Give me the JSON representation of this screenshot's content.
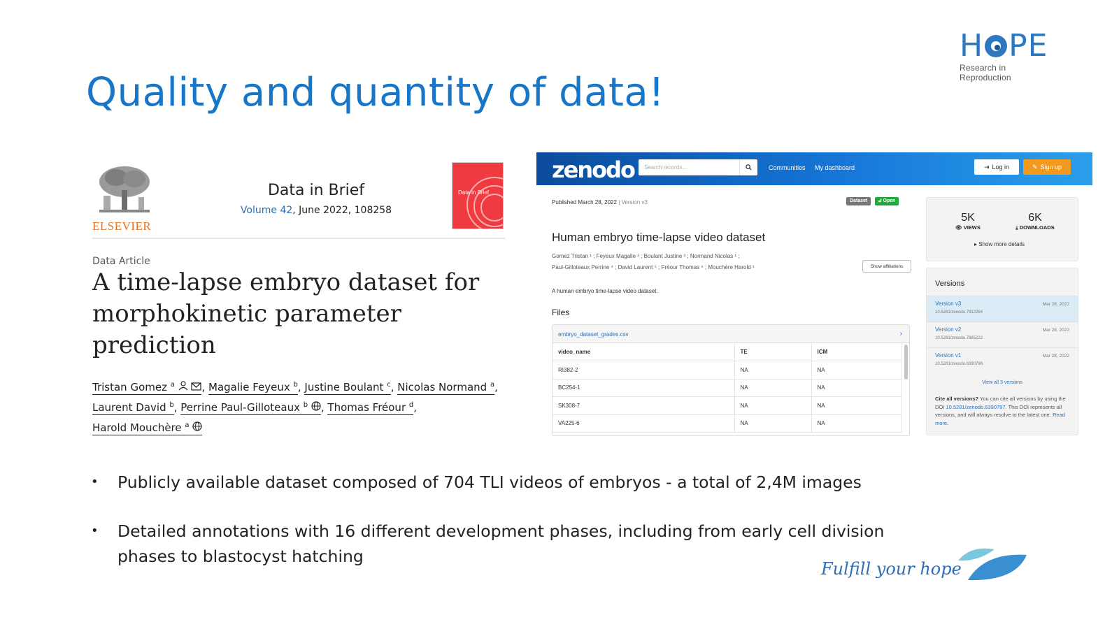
{
  "slide": {
    "title": "Quality and quantity of data!",
    "logo_word": "HOPE",
    "logo_sub": "Research in Reproduction",
    "tagline": "Fulfill your hope"
  },
  "article": {
    "publisher": "ELSEVIER",
    "journal": "Data in Brief",
    "volume_link": "Volume 42",
    "volume_rest": ", June 2022, 108258",
    "cover_text": "Data in Brief",
    "type": "Data Article",
    "title": "A time-lapse embryo dataset for morphokinetic parameter prediction",
    "authors": [
      {
        "name": "Tristan Gomez",
        "sup": "a"
      },
      {
        "name": "Magalie Feyeux",
        "sup": "b"
      },
      {
        "name": "Justine Boulant",
        "sup": "c"
      },
      {
        "name": "Nicolas Normand",
        "sup": "a"
      },
      {
        "name": "Laurent David",
        "sup": "b"
      },
      {
        "name": "Perrine Paul-Gilloteaux",
        "sup": "b"
      },
      {
        "name": "Thomas Fréour",
        "sup": "d"
      },
      {
        "name": "Harold Mouchère",
        "sup": "a"
      }
    ]
  },
  "zenodo": {
    "logo": "zenodo",
    "search_placeholder": "Search records...",
    "nav": [
      "Communities",
      "My dashboard"
    ],
    "login": "Log in",
    "signup": "Sign up",
    "published": "Published March 28, 2022",
    "version": "| Version v3",
    "badges": [
      "Dataset",
      "Open"
    ],
    "title": "Human embryo time-lapse video dataset",
    "authors_line1": "Gomez Tristan ¹ ; Feyeux Magalie ² ; Boulant Justine ³ ; Normand Nicolas ¹ ;",
    "authors_line2": "Paul-Gilloteaux Perrine ⁴ ; David Laurent ⁵ ; Fréour Thomas ⁶ ; Mouchère Harold ¹",
    "show_affiliations": "Show affiliations",
    "description": "A human embryo time-lapse video dataset.",
    "files_heading": "Files",
    "file_name": "embryo_dataset_grades.csv",
    "columns": [
      "video_name",
      "TE",
      "ICM"
    ],
    "rows": [
      [
        "RI382-2",
        "NA",
        "NA"
      ],
      [
        "BC254-1",
        "NA",
        "NA"
      ],
      [
        "SK308-7",
        "NA",
        "NA"
      ],
      [
        "VA225-6",
        "NA",
        "NA"
      ]
    ],
    "stats": [
      {
        "value": "5K",
        "label": "VIEWS"
      },
      {
        "value": "6K",
        "label": "DOWNLOADS"
      }
    ],
    "show_more": "Show more details",
    "versions_heading": "Versions",
    "versions": [
      {
        "name": "Version v3",
        "doi": "10.5281/zenodo.7912264",
        "date": "Mar 28, 2022"
      },
      {
        "name": "Version v2",
        "doi": "10.5281/zenodo.7885222",
        "date": "Mar 28, 2022"
      },
      {
        "name": "Version v1",
        "doi": "10.5281/zenodo.6390798",
        "date": "Mar 28, 2022"
      }
    ],
    "view_all": "View all 3 versions",
    "cite_bold": "Cite all versions?",
    "cite_text": " You can cite all versions by using the DOI ",
    "cite_doi": "10.5281/zenodo.6390797",
    "cite_text2": ". This DOI represents all versions, and will always resolve to the latest one. ",
    "read_more": "Read more."
  },
  "bullets": [
    "Publicly available dataset composed of 704 TLI videos of embryos - a total of 2,4M images",
    "Detailed annotations with 16 different development phases, including from early cell division phases to blastocyst hatching"
  ],
  "colors": {
    "title_blue": "#1876c8",
    "zenodo_orange": "#f39a1e",
    "elsevier_orange": "#e9711c"
  }
}
